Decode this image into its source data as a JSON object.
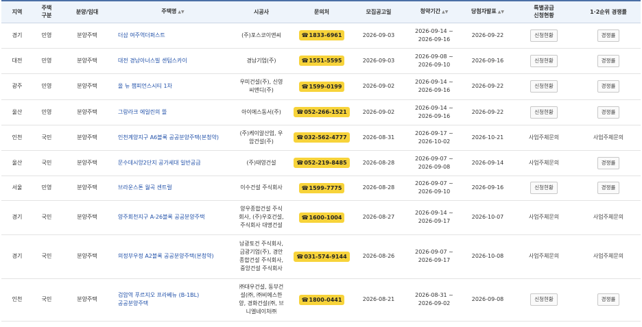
{
  "headers": {
    "region": "지역",
    "housing_type": "주택\n구분",
    "sale_lease": "분양/임대",
    "name": "주택명",
    "builder": "시공사",
    "contact": "문의처",
    "notice_date": "모집공고일",
    "period": "청약기간",
    "winner_date": "당첨자발표",
    "special": "특별공급\n신청현황",
    "competition": "1·2순위 경쟁률"
  },
  "sort_icon": "▲▼",
  "phone_icon": "☎",
  "rows": [
    {
      "region": "경기",
      "type": "민영",
      "sale": "분양주택",
      "name": "더샵 여주역더퍼스트",
      "builder": "(주)포스코이앤씨",
      "phone": "1833-6961",
      "notice": "2026-09-03",
      "period": "2026-09-14 ~\n2026-09-16",
      "winner": "2026-09-22",
      "special": "신청현황",
      "special_is_button": true,
      "comp": "경쟁률",
      "comp_is_button": true
    },
    {
      "region": "대전",
      "type": "민영",
      "sale": "분양주택",
      "name": "대전 경남아너스빌 센텀스카이",
      "builder": "경남기업(주)",
      "phone": "1551-5595",
      "notice": "2026-09-03",
      "period": "2026-09-08 ~\n2026-09-10",
      "winner": "2026-09-16",
      "special": "신청현황",
      "special_is_button": true,
      "comp": "경쟁률",
      "comp_is_button": true
    },
    {
      "region": "광주",
      "type": "민영",
      "sale": "분양주택",
      "name": "올 뉴 챔피언스시티 1차",
      "builder": "우미건설(주), 신영\n씨앤디(주)",
      "phone": "1599-0199",
      "notice": "2026-09-02",
      "period": "2026-09-14 ~\n2026-09-16",
      "winner": "2026-09-22",
      "special": "신청현황",
      "special_is_button": true,
      "comp": "경쟁률",
      "comp_is_button": true
    },
    {
      "region": "울산",
      "type": "민영",
      "sale": "분양주택",
      "name": "그랑라크 에일린의 뜰",
      "builder": "아이에스동서(주)",
      "phone": "052-266-1521",
      "notice": "2026-09-02",
      "period": "2026-09-14 ~\n2026-09-16",
      "winner": "2026-09-22",
      "special": "신청현황",
      "special_is_button": true,
      "comp": "경쟁률",
      "comp_is_button": true
    },
    {
      "region": "인천",
      "type": "국민",
      "sale": "분양주택",
      "name": "인천계양지구 A6블록 공공분양주택(본청약)",
      "builder": "(주)케이알산업, 우\n암건설(주)",
      "phone": "032-562-4777",
      "notice": "2026-08-31",
      "period": "2026-09-17 ~\n2026-10-02",
      "winner": "2026-10-21",
      "special": "사업주체문의",
      "special_is_button": false,
      "comp": "사업주체문의",
      "comp_is_button": false
    },
    {
      "region": "울산",
      "type": "국민",
      "sale": "분양주택",
      "name": "문수데시앙2단지 공가세대 일반공급",
      "builder": "(주)태영건설",
      "phone": "052-219-8485",
      "notice": "2026-08-28",
      "period": "2026-09-07 ~\n2026-09-08",
      "winner": "2026-09-14",
      "special": "사업주체문의",
      "special_is_button": false,
      "comp": "경쟁률",
      "comp_is_button": true
    },
    {
      "region": "서울",
      "type": "민영",
      "sale": "분양주택",
      "name": "브라운스톤 월곡 센트럴",
      "builder": "이수건설 주식회사",
      "phone": "1599-7775",
      "notice": "2026-08-28",
      "period": "2026-09-07 ~\n2026-09-10",
      "winner": "2026-09-16",
      "special": "신청현황",
      "special_is_button": true,
      "comp": "경쟁률",
      "comp_is_button": true
    },
    {
      "region": "경기",
      "type": "국민",
      "sale": "분양주택",
      "name": "양주회천지구 A-26블록 공공분양주택",
      "builder": "양우종합건설 주식\n회사, (주)우호건설,\n주식회사 대명건설",
      "phone": "1600-1004",
      "notice": "2026-08-27",
      "period": "2026-09-14 ~\n2026-09-17",
      "winner": "2026-10-07",
      "special": "사업주체문의",
      "special_is_button": false,
      "comp": "사업주체문의",
      "comp_is_button": false
    },
    {
      "region": "경기",
      "type": "국민",
      "sale": "분양주택",
      "name": "의정부우정 A2블록 공공분양주택(본청약)",
      "builder": "남광토건 주식회사,\n금광기업(주), 경안\n종합건설 주식회사,\n중앙건설 주식회사",
      "phone": "031-574-9144",
      "notice": "2026-08-26",
      "period": "2026-09-07 ~\n2026-09-17",
      "winner": "2026-10-08",
      "special": "사업주체문의",
      "special_is_button": false,
      "comp": "사업주체문의",
      "comp_is_button": false
    },
    {
      "region": "인천",
      "type": "국민",
      "sale": "분양주택",
      "name": "검암역 푸르지오 프라베뉴 (B-1BL)\n공공분양주택",
      "builder": "㈜대우건설, 동부건\n설(㈜, ㈜비에스한\n양, 경화건설(㈜, 브\n니엘네이처㈜",
      "phone": "1800-0441",
      "notice": "2026-08-21",
      "period": "2026-08-31 ~\n2026-09-02",
      "winner": "2026-09-08",
      "special": "신청현황",
      "special_is_button": true,
      "comp": "경쟁률",
      "comp_is_button": true
    }
  ]
}
